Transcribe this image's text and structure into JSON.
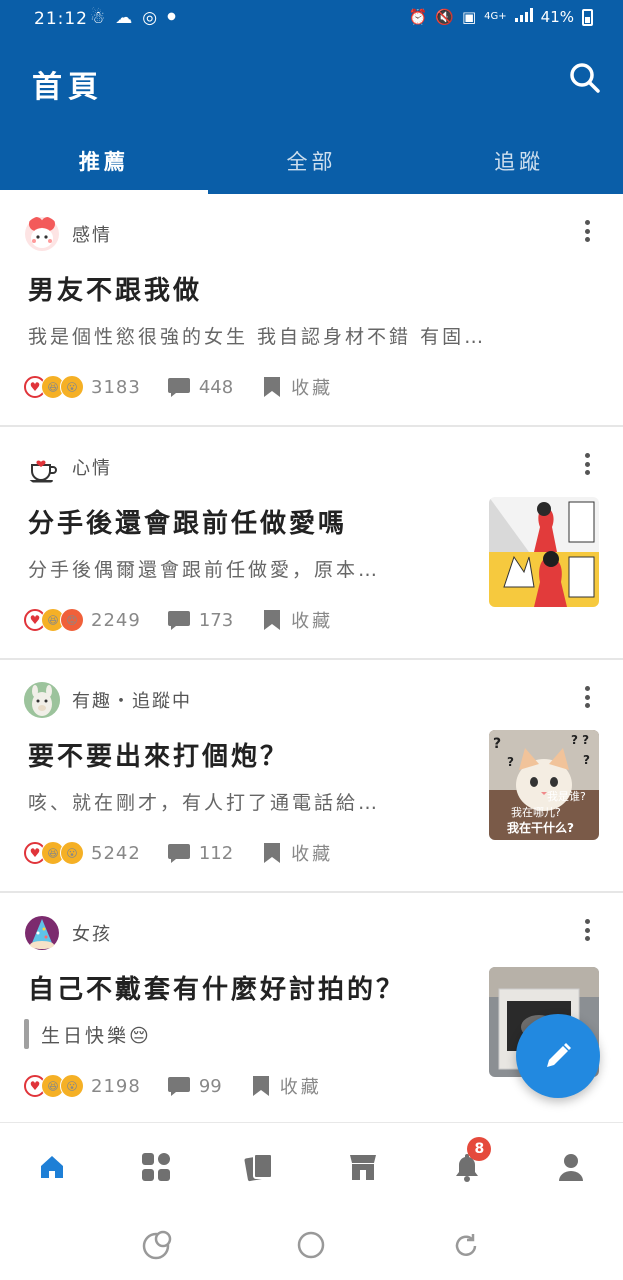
{
  "status_bar": {
    "time": "21:12",
    "network": "4G+",
    "battery": "41%"
  },
  "header": {
    "title": "首頁"
  },
  "tabs": [
    {
      "label": "推薦",
      "active": true
    },
    {
      "label": "全部",
      "active": false
    },
    {
      "label": "追蹤",
      "active": false
    }
  ],
  "posts": [
    {
      "board": "感情",
      "title": "男友不跟我做",
      "excerpt": "我是個性慾很強的女生 我自認身材不錯 有固…",
      "likes": "3183",
      "comments": "448",
      "bookmark_label": "收藏",
      "reactions": [
        "heart",
        "laugh",
        "wow"
      ]
    },
    {
      "board": "心情",
      "title": "分手後還會跟前任做愛嗎",
      "excerpt": "分手後偶爾還會跟前任做愛，原本…",
      "likes": "2249",
      "comments": "173",
      "bookmark_label": "收藏",
      "reactions": [
        "heart",
        "laugh",
        "angry"
      ]
    },
    {
      "board": "有趣・追蹤中",
      "title": "要不要出來打個炮？",
      "excerpt": "咳、就在剛才，有人打了通電話給…",
      "likes": "5242",
      "comments": "112",
      "bookmark_label": "收藏",
      "reactions": [
        "heart",
        "laugh",
        "wow"
      ],
      "thumb_caption_1": "我是谁?",
      "thumb_caption_2": "我在哪儿?",
      "thumb_caption_3": "我在干什么?"
    },
    {
      "board": "女孩",
      "title": "自己不戴套有什麼好討拍的？",
      "excerpt": "生日快樂😔",
      "likes": "2198",
      "comments": "99",
      "bookmark_label": "收藏",
      "reactions": [
        "heart",
        "laugh",
        "wow"
      ]
    }
  ],
  "bottom_nav": {
    "items": [
      "home-icon",
      "apps-icon",
      "cards-icon",
      "store-icon",
      "bell-icon",
      "profile-icon"
    ],
    "notification_badge": "8"
  },
  "colors": {
    "primary": "#0a5ea8",
    "fab": "#2289e0",
    "badge": "#e54a3c",
    "heart": "#e0343a"
  }
}
